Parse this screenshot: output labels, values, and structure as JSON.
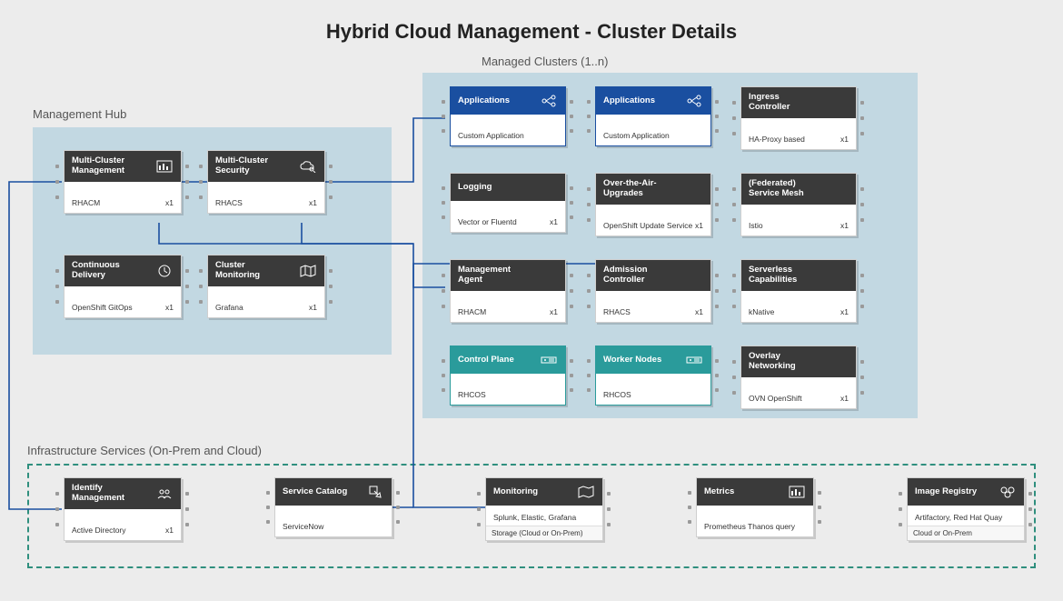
{
  "title": "Hybrid Cloud Management - Cluster Details",
  "zones": {
    "hub": "Management Hub",
    "managed": "Managed Clusters (1..n)",
    "infra": "Infrastructure Services (On-Prem and Cloud)"
  },
  "count_x1": "x1",
  "hub_cards": {
    "mcm": {
      "title": "Multi-Cluster Management",
      "sub": "RHACM"
    },
    "mcs": {
      "title": "Multi-Cluster Security",
      "sub": "RHACS"
    },
    "cd": {
      "title": "Continuous Delivery",
      "sub": "OpenShift GitOps"
    },
    "cmon": {
      "title": "Cluster Monitoring",
      "sub": "Grafana"
    }
  },
  "managed_cards": {
    "app1": {
      "title": "Applications",
      "sub": "Custom Application"
    },
    "app2": {
      "title": "Applications",
      "sub": "Custom Application"
    },
    "ingr": {
      "title": "Ingress Controller",
      "sub": "HA-Proxy based"
    },
    "log": {
      "title": "Logging",
      "sub": "Vector or Fluentd"
    },
    "ota": {
      "title": "Over-the-Air-Upgrades",
      "sub": "OpenShift Update Service"
    },
    "mesh": {
      "title": "(Federated) Service Mesh",
      "sub": "Istio"
    },
    "mga": {
      "title": "Management Agent",
      "sub": "RHACM"
    },
    "adm": {
      "title": "Admission Controller",
      "sub": "RHACS"
    },
    "svl": {
      "title": "Serverless Capabilities",
      "sub": "kNative"
    },
    "cp": {
      "title": "Control Plane",
      "sub": "RHCOS"
    },
    "wn": {
      "title": "Worker Nodes",
      "sub": "RHCOS"
    },
    "ovl": {
      "title": "Overlay Networking",
      "sub": "OVN OpenShift"
    }
  },
  "infra_cards": {
    "id": {
      "title": "Identify Management",
      "sub": "Active Directory"
    },
    "sc": {
      "title": "Service Catalog",
      "sub": "ServiceNow"
    },
    "mon": {
      "title": "Monitoring",
      "sub": "Splunk, Elastic, Grafana",
      "strip": "Storage (Cloud or On-Prem)"
    },
    "met": {
      "title": "Metrics",
      "sub": "Prometheus Thanos query"
    },
    "img": {
      "title": "Image Registry",
      "sub": "Artifactory, Red Hat Quay",
      "strip": "Cloud or On-Prem"
    }
  }
}
